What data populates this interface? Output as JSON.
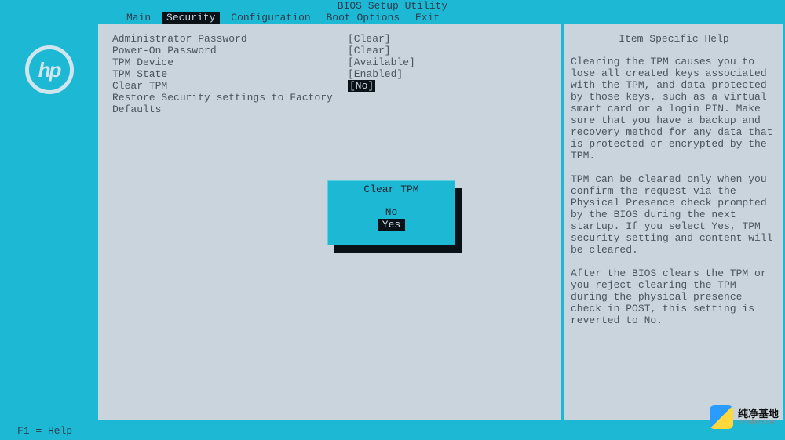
{
  "title": "BIOS Setup Utility",
  "menu": {
    "items": [
      "Main",
      "Security",
      "Configuration",
      "Boot Options",
      "Exit"
    ],
    "selected_index": 1
  },
  "settings": [
    {
      "label": "Administrator Password",
      "value": "[Clear]"
    },
    {
      "label": "Power-On Password",
      "value": "[Clear]"
    },
    {
      "label": "TPM Device",
      "value": "[Available]"
    },
    {
      "label": "TPM State",
      "value": "[Enabled]"
    },
    {
      "label": "Clear TPM",
      "value": "[No]",
      "selected": true
    },
    {
      "label": "Restore Security settings to Factory Defaults",
      "value": ""
    }
  ],
  "dialog": {
    "title": "Clear TPM",
    "options": [
      "No",
      "Yes"
    ],
    "selected_index": 1
  },
  "help": {
    "title": "Item Specific Help",
    "paragraphs": [
      "Clearing the TPM causes you to lose all created keys associated with the TPM, and data protected by those keys, such as a virtual smart card or a login PIN. Make sure that you have a backup and recovery method for any data that is protected or encrypted by the TPM.",
      "TPM can be cleared only when you confirm the request via the Physical Presence check prompted by the BIOS during the next startup. If you select Yes, TPM security setting and content will be cleared.",
      "After the BIOS clears the TPM or you reject clearing the TPM during the physical presence check in POST, this setting is reverted to No."
    ]
  },
  "footer": "F1 = Help",
  "logo_text": "hp",
  "watermark": {
    "cn": "纯净基地",
    "url": "czlaby.com"
  }
}
